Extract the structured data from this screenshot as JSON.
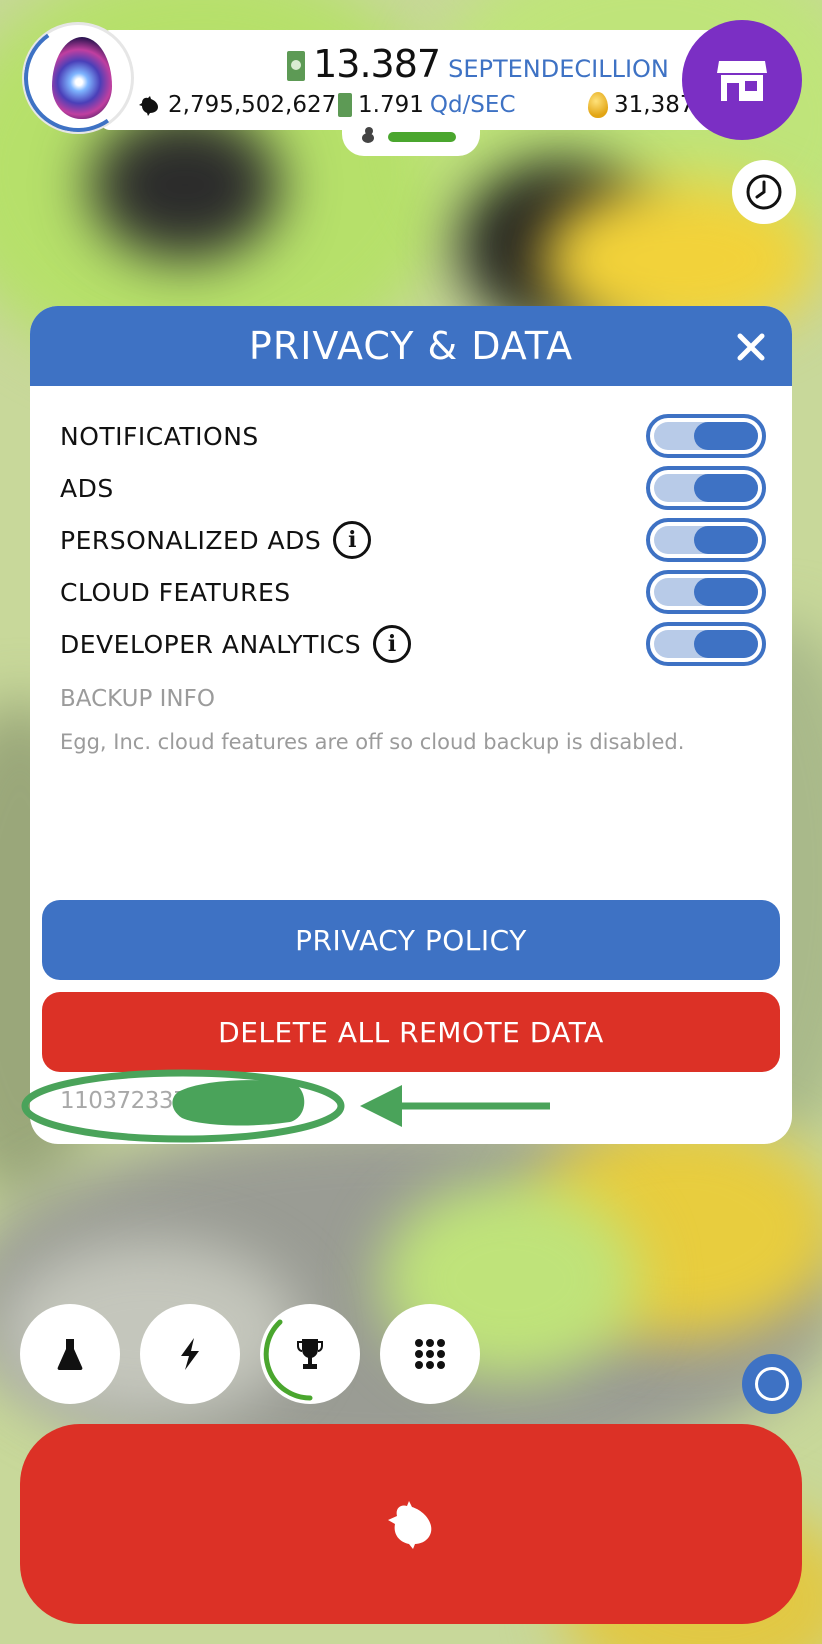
{
  "hud": {
    "money_value": "13.387",
    "money_unit": "SEPTENDECILLION",
    "chickens": "2,795,502,627",
    "earning_rate": "1.791",
    "earning_rate_unit": "Qd/SEC",
    "golden_eggs": "31,387",
    "hatch_progress": 0.75
  },
  "dialog": {
    "title": "PRIVACY & DATA",
    "settings": [
      {
        "label": "NOTIFICATIONS",
        "enabled": true,
        "info": false
      },
      {
        "label": "ADS",
        "enabled": true,
        "info": false
      },
      {
        "label": "PERSONALIZED ADS",
        "enabled": true,
        "info": true
      },
      {
        "label": "CLOUD FEATURES",
        "enabled": true,
        "info": false
      },
      {
        "label": "DEVELOPER ANALYTICS",
        "enabled": true,
        "info": true
      }
    ],
    "backup_title": "BACKUP INFO",
    "backup_text": "Egg, Inc. cloud features are off so cloud backup is disabled.",
    "privacy_policy_label": "PRIVACY POLICY",
    "delete_label": "DELETE ALL REMOTE DATA",
    "device_id_visible": "1103723372522"
  },
  "icons": {
    "shop": "shop-icon",
    "clock": "clock-icon",
    "close": "close-icon",
    "research": "flask-icon",
    "boosts": "lightning-icon",
    "trophy": "trophy-icon",
    "menu": "grid-menu-icon",
    "hatch": "chicken-icon"
  },
  "colors": {
    "primary_blue": "#3e72c4",
    "delete_red": "#dc3126",
    "shop_purple": "#7b2fc4",
    "annotation_green": "#4aa35a"
  }
}
